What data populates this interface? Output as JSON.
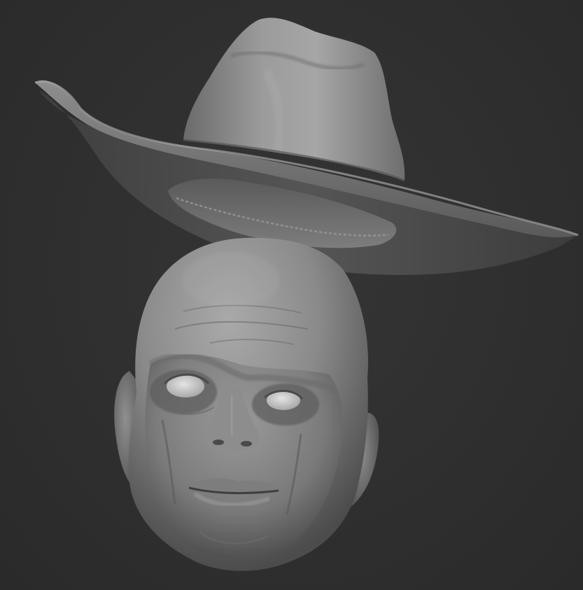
{
  "scene": {
    "background_color": "#2e2e2e",
    "material_color": "#8a8a8a",
    "objects": [
      "cowboy-hat",
      "head-sculpt"
    ]
  }
}
